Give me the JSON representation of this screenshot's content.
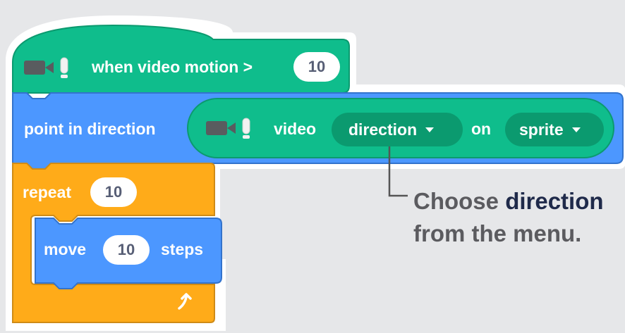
{
  "colors": {
    "background": "#e6e7e9",
    "video_green": "#0fbd8c",
    "video_dark": "#0b9a6f",
    "motion_blue": "#4c97ff",
    "control_orange": "#ffab19",
    "callout_line": "#555555",
    "callout_text": "#5b5b5f",
    "callout_emphasis": "#1f2a4a"
  },
  "hat_block": {
    "icon": "video-camera-icon",
    "label": "when video motion >",
    "value": "10"
  },
  "point_block": {
    "label": "point in direction",
    "reporter": {
      "icon": "video-camera-icon",
      "label_video": "video",
      "attribute_selected": "direction",
      "label_on": "on",
      "target_selected": "sprite"
    }
  },
  "repeat_block": {
    "label": "repeat",
    "value": "10",
    "loop_icon": "loop-arrow-icon"
  },
  "move_block": {
    "label_move": "move",
    "value": "10",
    "label_steps": "steps"
  },
  "callout": {
    "prefix": "Choose ",
    "emphasis": "direction",
    "line2": "from the menu."
  }
}
